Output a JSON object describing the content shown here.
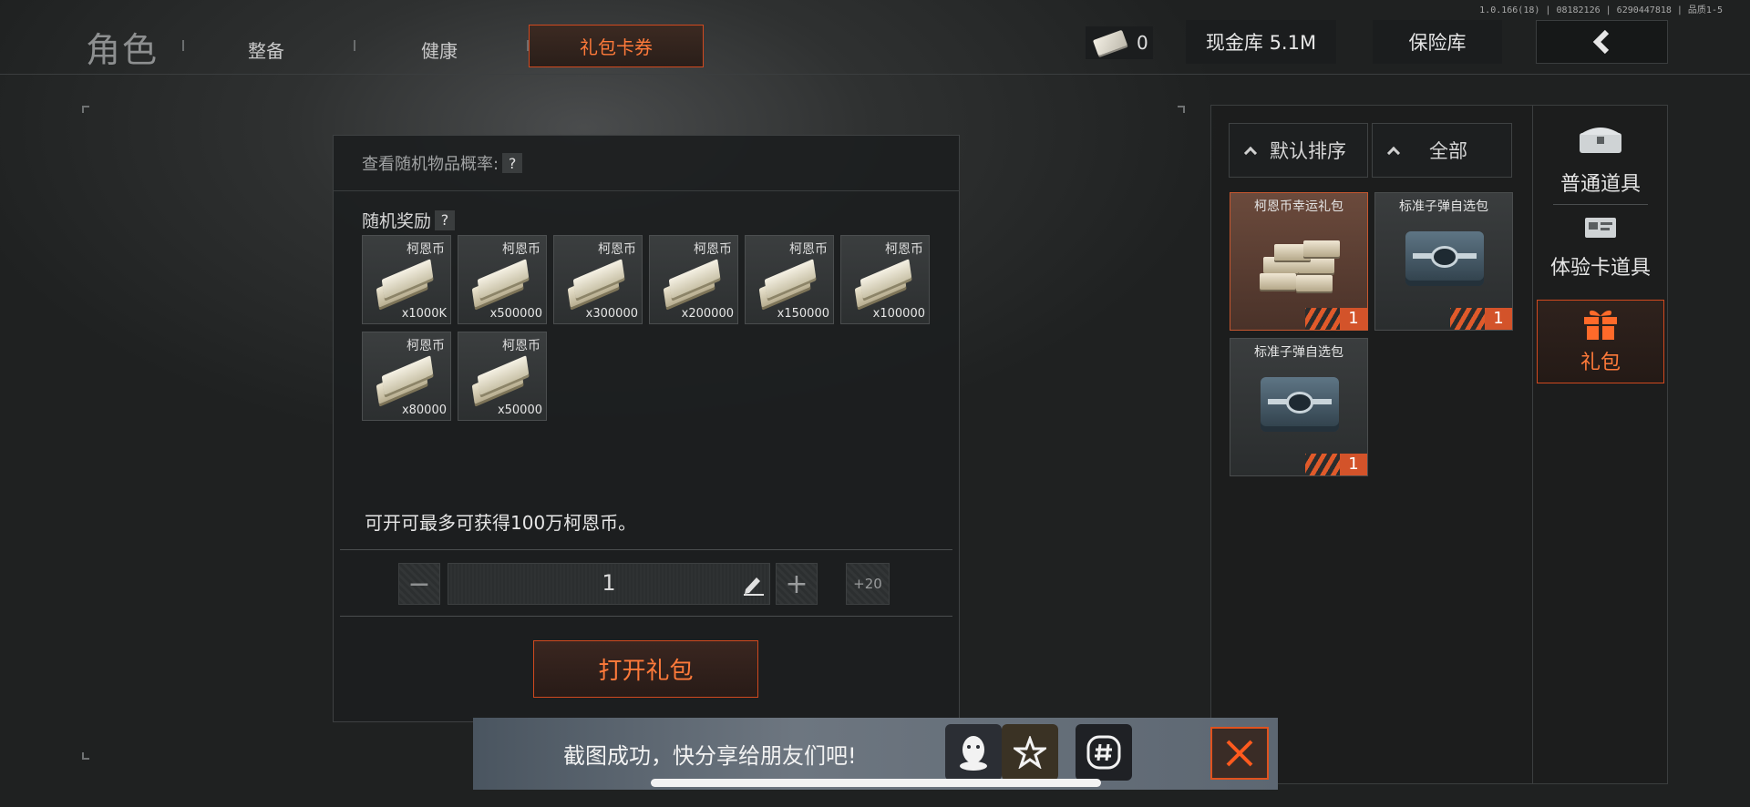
{
  "version": "1.0.166(18) | 08182126 | 6290447818 | 品质1-5",
  "header": {
    "title": "角色",
    "tabs": [
      {
        "label": "整备"
      },
      {
        "label": "健康"
      },
      {
        "label": "礼包卡券",
        "active": true
      }
    ],
    "cash_count": "0",
    "vault_label": "现金库 5.1M",
    "insurance_label": "保险库",
    "back_icon": "chevron-left-icon"
  },
  "detail": {
    "probability_label": "查看随机物品概率:",
    "help_mark": "?",
    "reward_label": "随机奖励",
    "rewards": [
      {
        "name": "柯恩币",
        "qty": "x1000K"
      },
      {
        "name": "柯恩币",
        "qty": "x500000"
      },
      {
        "name": "柯恩币",
        "qty": "x300000"
      },
      {
        "name": "柯恩币",
        "qty": "x200000"
      },
      {
        "name": "柯恩币",
        "qty": "x150000"
      },
      {
        "name": "柯恩币",
        "qty": "x100000"
      },
      {
        "name": "柯恩币",
        "qty": "x80000"
      },
      {
        "name": "柯恩币",
        "qty": "x50000"
      }
    ],
    "max_text": "可开可最多可获得100万柯恩币。",
    "quantity": "1",
    "minus_label": "−",
    "plus_label": "+",
    "plus20_label": "+20",
    "open_label": "打开礼包"
  },
  "inventory": {
    "sort_label": "默认排序",
    "filter_label": "全部",
    "items": [
      {
        "name": "柯恩币幸运礼包",
        "qty": "1",
        "selected": true,
        "icon": "money-pile-icon"
      },
      {
        "name": "标准子弹自选包",
        "qty": "1",
        "selected": false,
        "icon": "ammo-case-icon"
      },
      {
        "name": "标准子弹自选包",
        "qty": "1",
        "selected": false,
        "icon": "ammo-case-icon"
      }
    ],
    "categories": [
      {
        "label": "普通道具",
        "icon": "chest-icon"
      },
      {
        "label": "体验卡道具",
        "icon": "card-icon"
      },
      {
        "label": "礼包",
        "icon": "gift-icon",
        "active": true
      }
    ]
  },
  "share": {
    "text": "截图成功，快分享给朋友们吧!",
    "targets": [
      "qq-icon",
      "qzone-star-icon",
      "hash-share-icon"
    ]
  },
  "colors": {
    "accent": "#ff7a3a",
    "accent_border": "#d0491f"
  }
}
